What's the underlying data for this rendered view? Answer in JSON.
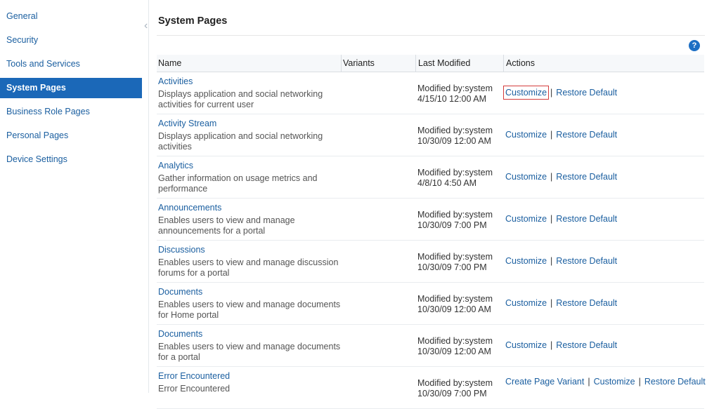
{
  "sidebar": {
    "items": [
      {
        "label": "General",
        "active": false
      },
      {
        "label": "Security",
        "active": false
      },
      {
        "label": "Tools and Services",
        "active": false
      },
      {
        "label": "System Pages",
        "active": true
      },
      {
        "label": "Business Role Pages",
        "active": false
      },
      {
        "label": "Personal Pages",
        "active": false
      },
      {
        "label": "Device Settings",
        "active": false
      }
    ]
  },
  "main": {
    "title": "System Pages",
    "help_label": "?",
    "columns": [
      "Name",
      "Variants",
      "Last Modified",
      "Actions"
    ],
    "separator": "|",
    "rows": [
      {
        "name": "Activities",
        "desc1": "Displays application and social networking",
        "desc2": "activities for current user",
        "mod1": "Modified by:system",
        "mod2": "4/15/10 12:00 AM",
        "actions": [
          "Customize",
          "Restore Default"
        ]
      },
      {
        "name": "Activity Stream",
        "desc1": "Displays application and social networking",
        "desc2": "activities",
        "mod1": "Modified by:system",
        "mod2": "10/30/09 12:00 AM",
        "actions": [
          "Customize",
          "Restore Default"
        ]
      },
      {
        "name": "Analytics",
        "desc1": "Gather information on usage metrics and",
        "desc2": "performance",
        "mod1": "Modified by:system",
        "mod2": "4/8/10 4:50 AM",
        "actions": [
          "Customize",
          "Restore Default"
        ]
      },
      {
        "name": "Announcements",
        "desc1": "Enables users to view and manage",
        "desc2": "announcements for a portal",
        "mod1": "Modified by:system",
        "mod2": "10/30/09 7:00 PM",
        "actions": [
          "Customize",
          "Restore Default"
        ]
      },
      {
        "name": "Discussions",
        "desc1": "Enables users to view and manage discussion",
        "desc2": "forums for a portal",
        "mod1": "Modified by:system",
        "mod2": "10/30/09 7:00 PM",
        "actions": [
          "Customize",
          "Restore Default"
        ]
      },
      {
        "name": "Documents",
        "desc1": "Enables users to view and manage documents",
        "desc2": "for Home portal",
        "mod1": "Modified by:system",
        "mod2": "10/30/09 12:00 AM",
        "actions": [
          "Customize",
          "Restore Default"
        ]
      },
      {
        "name": "Documents",
        "desc1": "Enables users to view and manage documents",
        "desc2": "for a portal",
        "mod1": "Modified by:system",
        "mod2": "10/30/09 12:00 AM",
        "actions": [
          "Customize",
          "Restore Default"
        ]
      },
      {
        "name": "Error Encountered",
        "desc1": "Error Encountered",
        "desc2": "",
        "mod1": "Modified by:system",
        "mod2": "10/30/09 7:00 PM",
        "actions": [
          "Create Page Variant",
          "Customize",
          "Restore Default"
        ]
      }
    ]
  }
}
